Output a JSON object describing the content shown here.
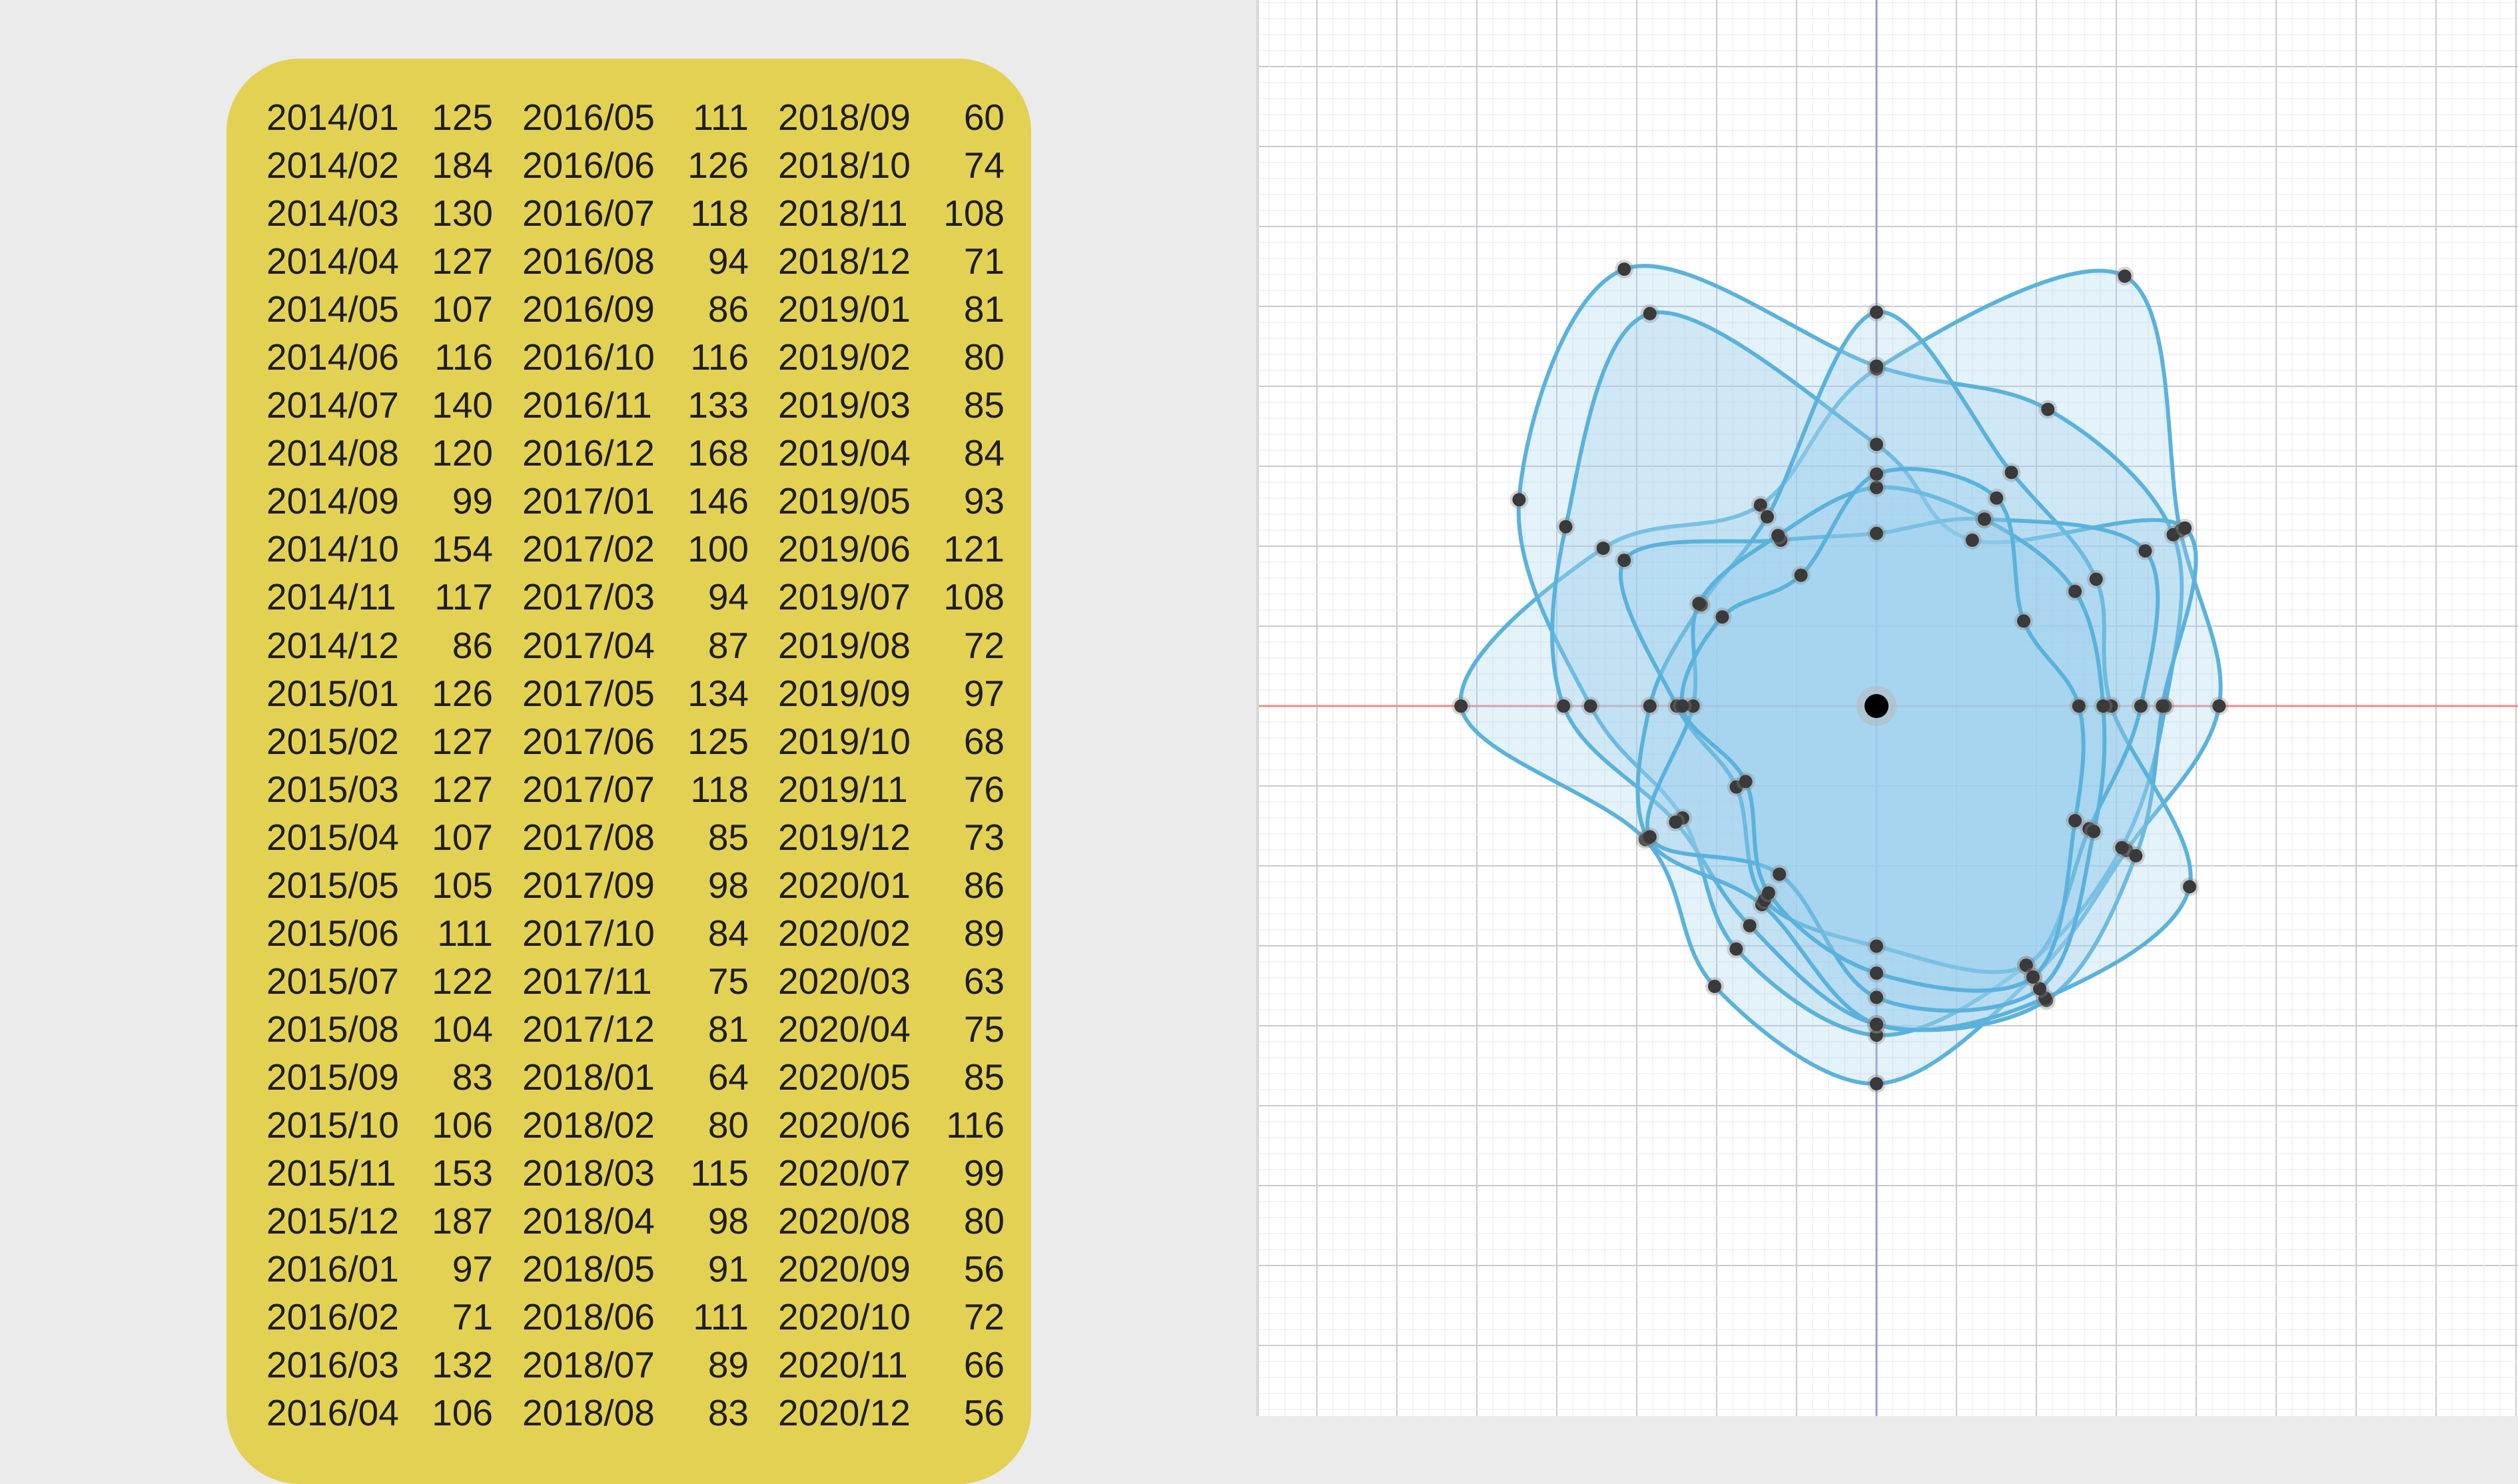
{
  "colors": {
    "card": "#e3d154",
    "curve_stroke": "#5ab2dc",
    "curve_fill": "#9fd1ec",
    "point": "#3a3a3a",
    "origin": "#000000",
    "x_axis": "#f08a8a",
    "y_axis": "#9a9ad8",
    "grid_minor": "#ececf2",
    "grid_major": "#c9c9d2"
  },
  "chart_data": {
    "type": "table",
    "columns": [
      {
        "rows": [
          {
            "date": "2014/01",
            "value": 125
          },
          {
            "date": "2014/02",
            "value": 184
          },
          {
            "date": "2014/03",
            "value": 130
          },
          {
            "date": "2014/04",
            "value": 127
          },
          {
            "date": "2014/05",
            "value": 107
          },
          {
            "date": "2014/06",
            "value": 116
          },
          {
            "date": "2014/07",
            "value": 140
          },
          {
            "date": "2014/08",
            "value": 120
          },
          {
            "date": "2014/09",
            "value": 99
          },
          {
            "date": "2014/10",
            "value": 154
          },
          {
            "date": "2014/11",
            "value": 117
          },
          {
            "date": "2014/12",
            "value": 86
          },
          {
            "date": "2015/01",
            "value": 126
          },
          {
            "date": "2015/02",
            "value": 127
          },
          {
            "date": "2015/03",
            "value": 127
          },
          {
            "date": "2015/04",
            "value": 107
          },
          {
            "date": "2015/05",
            "value": 105
          },
          {
            "date": "2015/06",
            "value": 111
          },
          {
            "date": "2015/07",
            "value": 122
          },
          {
            "date": "2015/08",
            "value": 104
          },
          {
            "date": "2015/09",
            "value": 83
          },
          {
            "date": "2015/10",
            "value": 106
          },
          {
            "date": "2015/11",
            "value": 153
          },
          {
            "date": "2015/12",
            "value": 187
          },
          {
            "date": "2016/01",
            "value": 97
          },
          {
            "date": "2016/02",
            "value": 71
          },
          {
            "date": "2016/03",
            "value": 132
          },
          {
            "date": "2016/04",
            "value": 106
          }
        ]
      },
      {
        "rows": [
          {
            "date": "2016/05",
            "value": 111
          },
          {
            "date": "2016/06",
            "value": 126
          },
          {
            "date": "2016/07",
            "value": 118
          },
          {
            "date": "2016/08",
            "value": 94
          },
          {
            "date": "2016/09",
            "value": 86
          },
          {
            "date": "2016/10",
            "value": 116
          },
          {
            "date": "2016/11",
            "value": 133
          },
          {
            "date": "2016/12",
            "value": 168
          },
          {
            "date": "2017/01",
            "value": 146
          },
          {
            "date": "2017/02",
            "value": 100
          },
          {
            "date": "2017/03",
            "value": 94
          },
          {
            "date": "2017/04",
            "value": 87
          },
          {
            "date": "2017/05",
            "value": 134
          },
          {
            "date": "2017/06",
            "value": 125
          },
          {
            "date": "2017/07",
            "value": 118
          },
          {
            "date": "2017/08",
            "value": 85
          },
          {
            "date": "2017/09",
            "value": 98
          },
          {
            "date": "2017/10",
            "value": 84
          },
          {
            "date": "2017/11",
            "value": 75
          },
          {
            "date": "2017/12",
            "value": 81
          },
          {
            "date": "2018/01",
            "value": 64
          },
          {
            "date": "2018/02",
            "value": 80
          },
          {
            "date": "2018/03",
            "value": 115
          },
          {
            "date": "2018/04",
            "value": 98
          },
          {
            "date": "2018/05",
            "value": 91
          },
          {
            "date": "2018/06",
            "value": 111
          },
          {
            "date": "2018/07",
            "value": 89
          },
          {
            "date": "2018/08",
            "value": 83
          }
        ]
      },
      {
        "rows": [
          {
            "date": "2018/09",
            "value": 60
          },
          {
            "date": "2018/10",
            "value": 74
          },
          {
            "date": "2018/11",
            "value": 108
          },
          {
            "date": "2018/12",
            "value": 71
          },
          {
            "date": "2019/01",
            "value": 81
          },
          {
            "date": "2019/02",
            "value": 80
          },
          {
            "date": "2019/03",
            "value": 85
          },
          {
            "date": "2019/04",
            "value": 84
          },
          {
            "date": "2019/05",
            "value": 93
          },
          {
            "date": "2019/06",
            "value": 121
          },
          {
            "date": "2019/07",
            "value": 108
          },
          {
            "date": "2019/08",
            "value": 72
          },
          {
            "date": "2019/09",
            "value": 97
          },
          {
            "date": "2019/10",
            "value": 68
          },
          {
            "date": "2019/11",
            "value": 76
          },
          {
            "date": "2019/12",
            "value": 73
          },
          {
            "date": "2020/01",
            "value": 86
          },
          {
            "date": "2020/02",
            "value": 89
          },
          {
            "date": "2020/03",
            "value": 63
          },
          {
            "date": "2020/04",
            "value": 75
          },
          {
            "date": "2020/05",
            "value": 85
          },
          {
            "date": "2020/06",
            "value": 116
          },
          {
            "date": "2020/07",
            "value": 99
          },
          {
            "date": "2020/08",
            "value": 80
          },
          {
            "date": "2020/09",
            "value": 56
          },
          {
            "date": "2020/10",
            "value": 72
          },
          {
            "date": "2020/11",
            "value": 66
          },
          {
            "date": "2020/12",
            "value": 56
          }
        ]
      }
    ],
    "polar": {
      "type": "radial-closed-curves",
      "series": [
        {
          "values": [
            125,
            184,
            130,
            127,
            107,
            116,
            140,
            120,
            99,
            154,
            117,
            86
          ]
        },
        {
          "values": [
            126,
            127,
            127,
            107,
            105,
            111,
            122,
            104,
            83,
            106,
            153,
            187
          ]
        },
        {
          "values": [
            97,
            71,
            132,
            106,
            111,
            126,
            118,
            94,
            86,
            116,
            133,
            168
          ]
        },
        {
          "values": [
            146,
            100,
            94,
            87,
            134,
            125,
            118,
            85,
            98,
            84,
            75,
            81
          ]
        },
        {
          "values": [
            64,
            80,
            115,
            98,
            91,
            111,
            89,
            83,
            60,
            74,
            108,
            71
          ]
        },
        {
          "values": [
            81,
            80,
            85,
            84,
            93,
            121,
            108,
            72,
            97,
            68,
            76,
            73
          ]
        },
        {
          "values": [
            86,
            89,
            63,
            75,
            85,
            116,
            99,
            80,
            56,
            72,
            66,
            56
          ]
        }
      ],
      "grid": true
    }
  }
}
